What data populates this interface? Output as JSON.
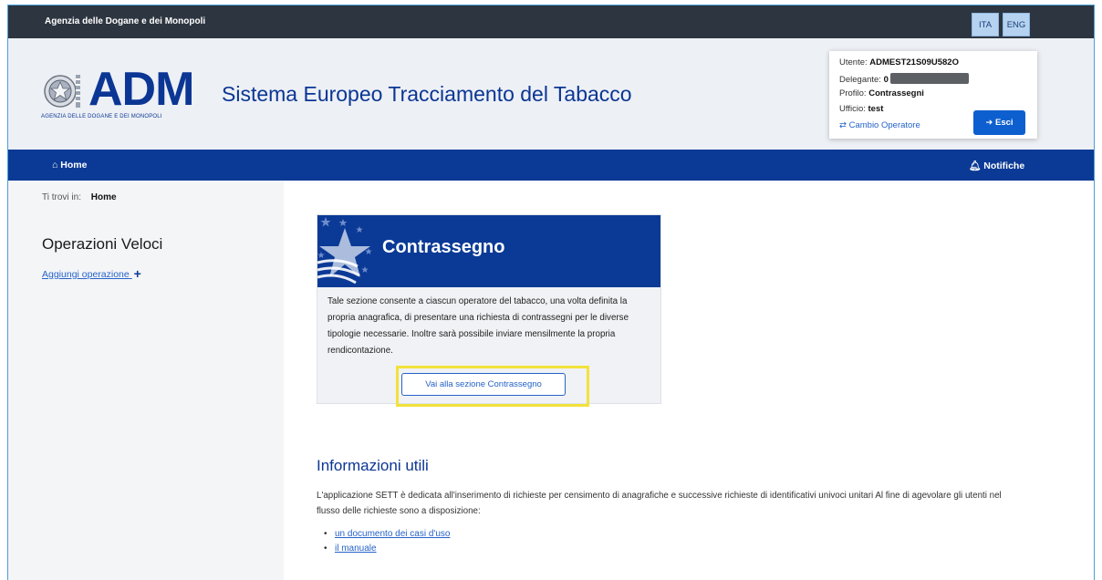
{
  "topbar": {
    "agency_name": "Agenzia delle Dogane e dei Monopoli",
    "lang_ita": "ITA",
    "lang_eng": "ENG"
  },
  "header": {
    "logo_text": "ADM",
    "logo_subtitle": "AGENZIA DELLE DOGANE E DEI MONOPOLI",
    "site_title": "Sistema Europeo Tracciamento del Tabacco"
  },
  "user": {
    "utente_label": "Utente:",
    "utente_value": "ADMEST21S09U582O",
    "delegante_label": "Delegante:",
    "delegante_value": "0",
    "profilo_label": "Profilo:",
    "profilo_value": "Contrassegni",
    "ufficio_label": "Ufficio:",
    "ufficio_value": "test",
    "cambio_label": "Cambio Operatore",
    "esci_label": "Esci"
  },
  "nav": {
    "home_label": "Home",
    "notifiche_label": "Notifiche"
  },
  "sidebar": {
    "breadcrumb_prefix": "Ti trovi in:",
    "breadcrumb_current": "Home",
    "quick_title": "Operazioni Veloci",
    "add_operation": "Aggiungi operazione"
  },
  "card": {
    "title": "Contrassegno",
    "description": "Tale sezione consente a ciascun operatore del tabacco, una volta definita la propria anagrafica, di presentare una richiesta di contrassegni per le diverse tipologie necessarie. Inoltre sarà possibile inviare mensilmente la propria rendicontazione.",
    "button_label": "Vai alla sezione Contrassegno"
  },
  "info": {
    "title": "Informazioni utili",
    "text": "L'applicazione SETT è dedicata all'inserimento di richieste per censimento di anagrafiche e successive richieste di identificativi univoci unitari Al fine di agevolare gli utenti nel flusso delle richieste sono a disposizione:",
    "links": [
      "un documento dei casi d'uso",
      "il manuale"
    ]
  },
  "colors": {
    "brand_blue": "#0b3a96",
    "link_blue": "#2563c9",
    "highlight_yellow": "#f2e23a",
    "topbar_dark": "#2d3540"
  }
}
